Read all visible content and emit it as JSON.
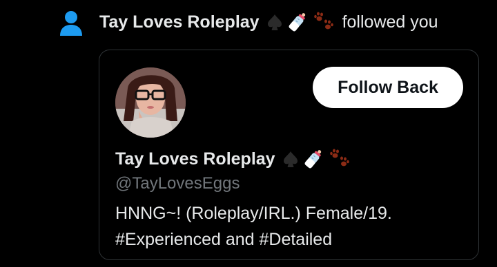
{
  "notification": {
    "user_name": "Tay Loves Roleplay",
    "action_text": "followed you",
    "icon": "person-icon",
    "icon_color": "#1d9bf0"
  },
  "name_emojis": [
    "spade-icon",
    "baby-bottle-icon",
    "paw-prints-icon"
  ],
  "card": {
    "user_name": "Tay Loves Roleplay",
    "handle": "@TayLovesEggs",
    "bio_lines": [
      "HNNG~! (Roleplay/IRL.) Female/19.",
      "#Experienced and #Detailed"
    ],
    "follow_button_label": "Follow Back"
  },
  "colors": {
    "background": "#000000",
    "primary_text": "#e7e9ea",
    "secondary_text": "#71767b",
    "card_border": "#2f3336",
    "button_bg": "#ffffff",
    "button_text": "#0f1419"
  }
}
